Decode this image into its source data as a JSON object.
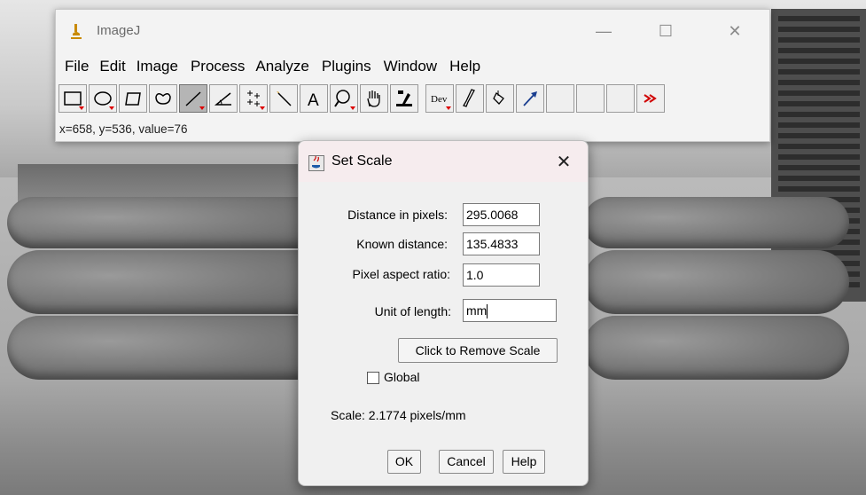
{
  "imagej": {
    "title": "ImageJ",
    "menus": [
      "File",
      "Edit",
      "Image",
      "Process",
      "Analyze",
      "Plugins",
      "Window",
      "Help"
    ],
    "tools": [
      {
        "name": "rectangle-tool",
        "icon": "rectangle-icon"
      },
      {
        "name": "oval-tool",
        "icon": "oval-icon"
      },
      {
        "name": "polygon-tool",
        "icon": "polygon-icon"
      },
      {
        "name": "freehand-tool",
        "icon": "freehand-icon"
      },
      {
        "name": "line-tool",
        "icon": "line-icon"
      },
      {
        "name": "angle-tool",
        "icon": "angle-icon"
      },
      {
        "name": "point-tool",
        "icon": "multipoint-icon"
      },
      {
        "name": "wand-tool",
        "icon": "wand-icon"
      },
      {
        "name": "text-tool",
        "icon": "text-icon"
      },
      {
        "name": "zoom-tool",
        "icon": "magnifier-icon"
      },
      {
        "name": "hand-tool",
        "icon": "hand-icon"
      },
      {
        "name": "dropper-tool",
        "icon": "dropper-icon"
      },
      {
        "name": "dev-tool",
        "icon": "dev-icon",
        "label": "Dev"
      },
      {
        "name": "brush-tool",
        "icon": "brush-icon"
      },
      {
        "name": "flood-tool",
        "icon": "flood-fill-icon"
      },
      {
        "name": "arrow-tool",
        "icon": "arrow-icon"
      },
      {
        "name": "empty-tool-1",
        "icon": ""
      },
      {
        "name": "empty-tool-2",
        "icon": ""
      },
      {
        "name": "empty-tool-3",
        "icon": ""
      },
      {
        "name": "more-tools",
        "icon": "double-chevron-icon"
      }
    ],
    "status": "x=658, y=536, value=76"
  },
  "dialog": {
    "title": "Set Scale",
    "distance_label": "Distance in pixels:",
    "distance_value": "295.0068",
    "known_label": "Known distance:",
    "known_value": "135.4833",
    "aspect_label": "Pixel aspect ratio:",
    "aspect_value": "1.0",
    "unit_label": "Unit of length:",
    "unit_value": "mm",
    "remove_label": "Click to Remove Scale",
    "global_label": "Global",
    "global_checked": false,
    "scale_text": "Scale: 2.1774 pixels/mm",
    "ok_label": "OK",
    "cancel_label": "Cancel",
    "help_label": "Help"
  },
  "colors": {
    "active_tool": "#b5b5b5",
    "more_tools_red": "#d00000",
    "dialog_title_bg": "#f6ecee"
  }
}
